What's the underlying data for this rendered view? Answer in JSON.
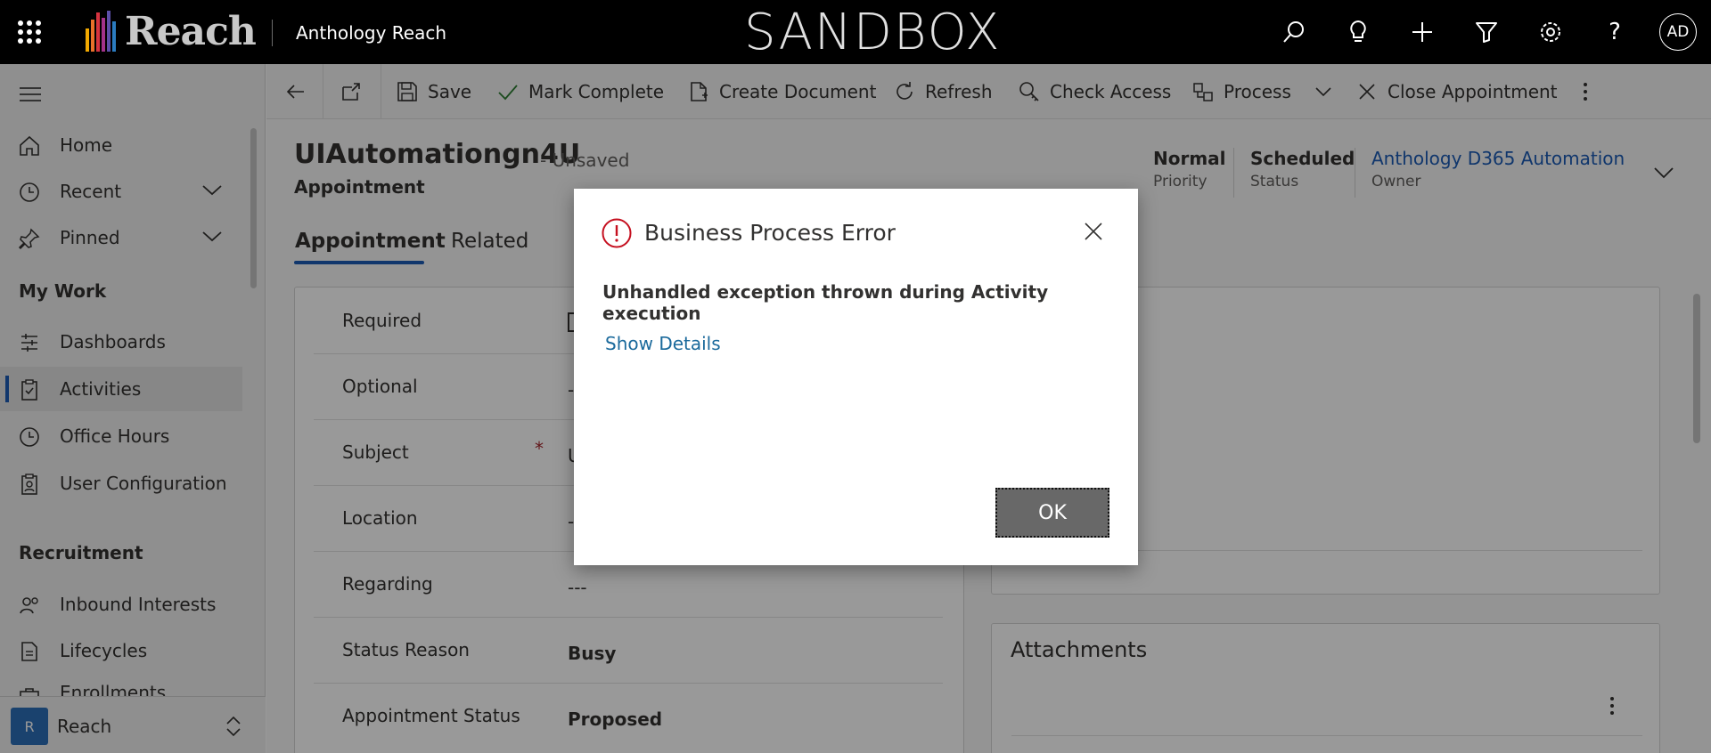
{
  "topbar": {
    "logo_text": "Reach",
    "app_name": "Anthology Reach",
    "environment_banner": "SANDBOX",
    "icons": [
      "search-icon",
      "lightbulb-icon",
      "plus-icon",
      "filter-icon",
      "gear-icon",
      "help-icon"
    ],
    "avatar_initials": "AD"
  },
  "sidebar": {
    "items": [
      {
        "label": "Home",
        "icon": "home-icon"
      },
      {
        "label": "Recent",
        "icon": "clock-icon",
        "expandable": true
      },
      {
        "label": "Pinned",
        "icon": "pin-icon",
        "expandable": true
      }
    ],
    "my_work_heading": "My Work",
    "my_work_items": [
      {
        "label": "Dashboards",
        "icon": "dashboard-icon"
      },
      {
        "label": "Activities",
        "icon": "clipboard-icon",
        "active": true
      },
      {
        "label": "Office Hours",
        "icon": "clock-icon"
      },
      {
        "label": "User Configuration",
        "icon": "clipboard-user-icon"
      }
    ],
    "recruitment_heading": "Recruitment",
    "recruitment_items": [
      {
        "label": "Inbound Interests",
        "icon": "people-icon"
      },
      {
        "label": "Lifecycles",
        "icon": "document-icon"
      },
      {
        "label": "Enrollments",
        "icon": "briefcase-icon"
      }
    ],
    "area": {
      "badge": "R",
      "label": "Reach"
    }
  },
  "commandbar": {
    "save": "Save",
    "mark_complete": "Mark Complete",
    "create_document": "Create Document",
    "refresh": "Refresh",
    "check_access": "Check Access",
    "process": "Process",
    "close_appointment": "Close Appointment"
  },
  "record": {
    "title": "UIAutomationgn4U",
    "unsaved": "- Unsaved",
    "entity": "Appointment",
    "header_fields": [
      {
        "value": "Normal",
        "label": "Priority"
      },
      {
        "value": "Scheduled",
        "label": "Status"
      },
      {
        "value": "Anthology D365 Automation",
        "label": "Owner"
      }
    ],
    "tabs": [
      "Appointment",
      "Related"
    ],
    "fields": [
      {
        "label": "Required",
        "value": ""
      },
      {
        "label": "Optional",
        "value": "---"
      },
      {
        "label": "Subject",
        "value": "U",
        "required": true
      },
      {
        "label": "Location",
        "value": "---"
      },
      {
        "label": "Regarding",
        "value": "---"
      },
      {
        "label": "Status Reason",
        "value": "Busy"
      },
      {
        "label": "Appointment Status",
        "value": "Proposed"
      }
    ],
    "attachments_title": "Attachments"
  },
  "dialog": {
    "title": "Business Process Error",
    "message": "Unhandled exception thrown during Activity execution",
    "details_link": "Show Details",
    "ok_label": "OK",
    "error_color": "#c50f1f"
  }
}
